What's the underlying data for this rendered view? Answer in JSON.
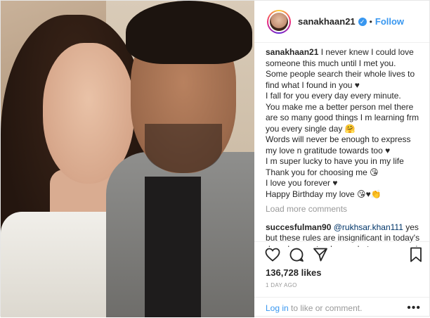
{
  "header": {
    "username": "sanakhaan21",
    "separator": "•",
    "follow_label": "Follow"
  },
  "caption": {
    "username": "sanakhaan21",
    "lines": [
      "I never knew I could love someone this much until I met you.",
      "Some people search their whole lives to find what I found in you ♥",
      "I fall for you every day every minute.",
      "You make me a better person mel there are so many good things I m learning frm you every single day 🤗",
      "Words will never be enough to express my love n gratitude towards too ♥",
      "I m super lucky to have you in my life",
      "Thank you for choosing me 😘",
      "I love you forever ♥",
      "Happy Birthday my love 😘♥👏"
    ]
  },
  "load_more_label": "Load more comments",
  "comment": {
    "username": "succesfulman90",
    "mention": "@rukhsar.khan111",
    "text": "yes but these rules are insignificant in today's day where not only men but woman are in full and equal control of the relationship and"
  },
  "likes": "136,728 likes",
  "timestamp": "1 DAY AGO",
  "login": {
    "link": "Log in",
    "rest": "to like or comment."
  },
  "more_icon": "•••",
  "icons": [
    "heart-icon",
    "comment-icon",
    "share-icon",
    "bookmark-icon"
  ],
  "colors": {
    "link_blue": "#3897f0",
    "muted": "#999999",
    "text": "#262626"
  }
}
